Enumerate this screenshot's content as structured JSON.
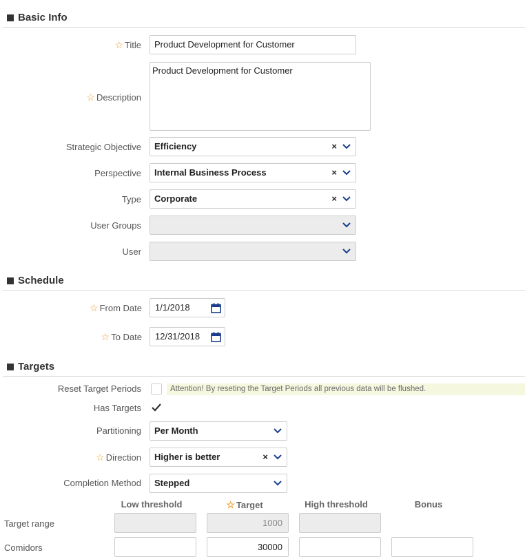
{
  "basic_info": {
    "header": "Basic Info",
    "title_label": "Title",
    "title_value": "Product Development for Customer",
    "description_label": "Description",
    "description_value": "Product Development for Customer",
    "strategic_objective_label": "Strategic Objective",
    "strategic_objective_value": "Efficiency",
    "perspective_label": "Perspective",
    "perspective_value": "Internal Business Process",
    "type_label": "Type",
    "type_value": "Corporate",
    "user_groups_label": "User Groups",
    "user_groups_value": "",
    "user_label": "User",
    "user_value": "",
    "clear_glyph": "×"
  },
  "schedule": {
    "header": "Schedule",
    "from_date_label": "From Date",
    "from_date_value": "1/1/2018",
    "to_date_label": "To Date",
    "to_date_value": "12/31/2018"
  },
  "targets": {
    "header": "Targets",
    "reset_label": "Reset Target Periods",
    "reset_checked": false,
    "attention_text": "Attention! By reseting the Target Periods all previous data will be flushed.",
    "has_targets_label": "Has Targets",
    "has_targets_checked": true,
    "partitioning_label": "Partitioning",
    "partitioning_value": "Per Month",
    "direction_label": "Direction",
    "direction_value": "Higher is better",
    "completion_label": "Completion Method",
    "completion_value": "Stepped",
    "columns": [
      "Low threshold",
      "Target",
      "High threshold",
      "Bonus"
    ],
    "rows": [
      {
        "label": "Target range",
        "values": [
          "",
          "1000",
          "",
          ""
        ]
      },
      {
        "label": "Comidors",
        "values": [
          "",
          "30000",
          "",
          ""
        ]
      }
    ]
  },
  "colors": {
    "required_star": "#f0a030",
    "chevron": "#1a3e8c",
    "attention_bg": "#f6f7df",
    "disabled_bg": "#ececec"
  },
  "icons": {
    "required": "star-outline",
    "dropdown": "chevron-down",
    "calendar": "calendar",
    "check": "checkmark"
  }
}
